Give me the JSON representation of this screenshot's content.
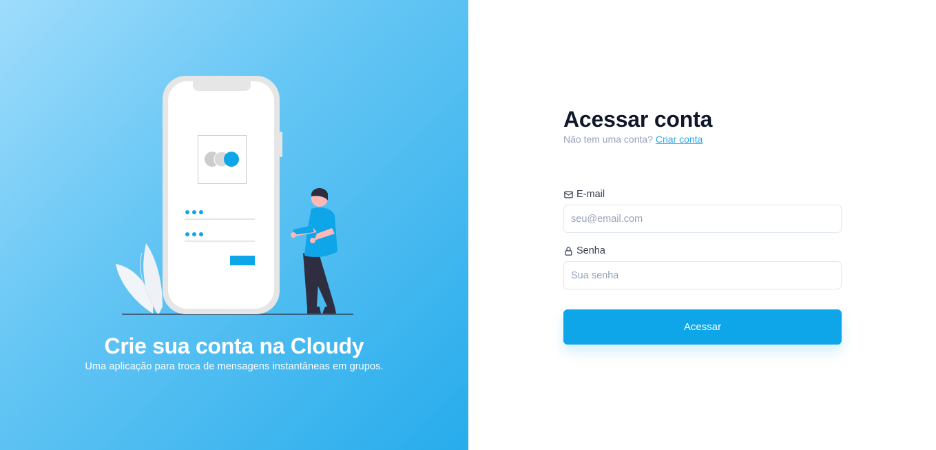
{
  "colors": {
    "accent": "#0ea5e9",
    "link": "#2ea7e8",
    "title": "#0f172a",
    "muted": "#94a3b8",
    "panel_gradient_start": "#9fdcfc",
    "panel_gradient_end": "#27acec"
  },
  "hero": {
    "title": "Crie sua conta na Cloudy",
    "subtitle": "Uma aplicação para troca de mensagens instantâneas em grupos.",
    "illustration_icons": [
      "phone-icon",
      "person-icon",
      "leaf-icon"
    ]
  },
  "login": {
    "title": "Acessar conta",
    "signup_prompt": "Não tem uma conta?",
    "signup_link": "Criar conta",
    "email": {
      "icon": "mail-icon",
      "label": "E-mail",
      "placeholder": "seu@email.com",
      "value": ""
    },
    "password": {
      "icon": "lock-icon",
      "label": "Senha",
      "placeholder": "Sua senha",
      "value": ""
    },
    "submit_label": "Acessar"
  }
}
